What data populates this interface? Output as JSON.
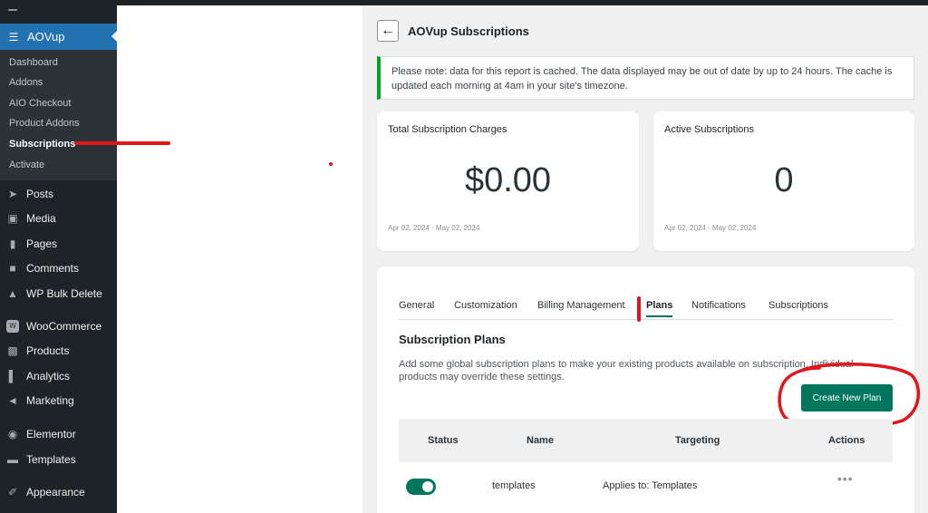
{
  "sidebar": {
    "active_plugin": "AOVup",
    "submenu": [
      "Dashboard",
      "Addons",
      "AIO Checkout",
      "Product Addons",
      "Subscriptions",
      "Activate"
    ],
    "active_submenu": "Subscriptions",
    "menu": [
      {
        "label": "Posts",
        "icon": "pin-icon"
      },
      {
        "label": "Media",
        "icon": "media-icon"
      },
      {
        "label": "Pages",
        "icon": "pages-icon"
      },
      {
        "label": "Comments",
        "icon": "comments-icon"
      },
      {
        "label": "WP Bulk Delete",
        "icon": "trash-icon"
      },
      {
        "label": "WooCommerce",
        "icon": "woocommerce-icon"
      },
      {
        "label": "Products",
        "icon": "products-icon"
      },
      {
        "label": "Analytics",
        "icon": "analytics-icon"
      },
      {
        "label": "Marketing",
        "icon": "megaphone-icon"
      },
      {
        "label": "Elementor",
        "icon": "elementor-icon"
      },
      {
        "label": "Templates",
        "icon": "folder-icon"
      },
      {
        "label": "Appearance",
        "icon": "brush-icon"
      }
    ]
  },
  "header": {
    "title": "AOVup Subscriptions"
  },
  "notice": {
    "text": "Please note: data for this report is cached. The data displayed may be out of date by up to 24 hours. The cache is updated each morning at 4am in your site's timezone."
  },
  "cards": [
    {
      "title": "Total Subscription Charges",
      "value": "$0.00",
      "range": "Apr 02, 2024 - May 02, 2024"
    },
    {
      "title": "Active Subscriptions",
      "value": "0",
      "range": "Apr 02, 2024 - May 02, 2024"
    }
  ],
  "tabs": [
    "General",
    "Customization",
    "Billing Management",
    "Plans",
    "Notifications",
    "Subscriptions"
  ],
  "active_tab": "Plans",
  "plans_section": {
    "title": "Subscription Plans",
    "description": "Add some global subscription plans to make your existing products available on subscription. Individual products may override these settings.",
    "create_label": "Create New Plan"
  },
  "table": {
    "columns": [
      "Status",
      "Name",
      "Targeting",
      "Actions"
    ],
    "rows": [
      {
        "status": "enabled",
        "name": "templates",
        "targeting": "Applies to: Templates"
      }
    ]
  },
  "colors": {
    "accent_green": "#00765e",
    "wp_blue": "#2271b1",
    "annotation_red": "#e0161b"
  }
}
